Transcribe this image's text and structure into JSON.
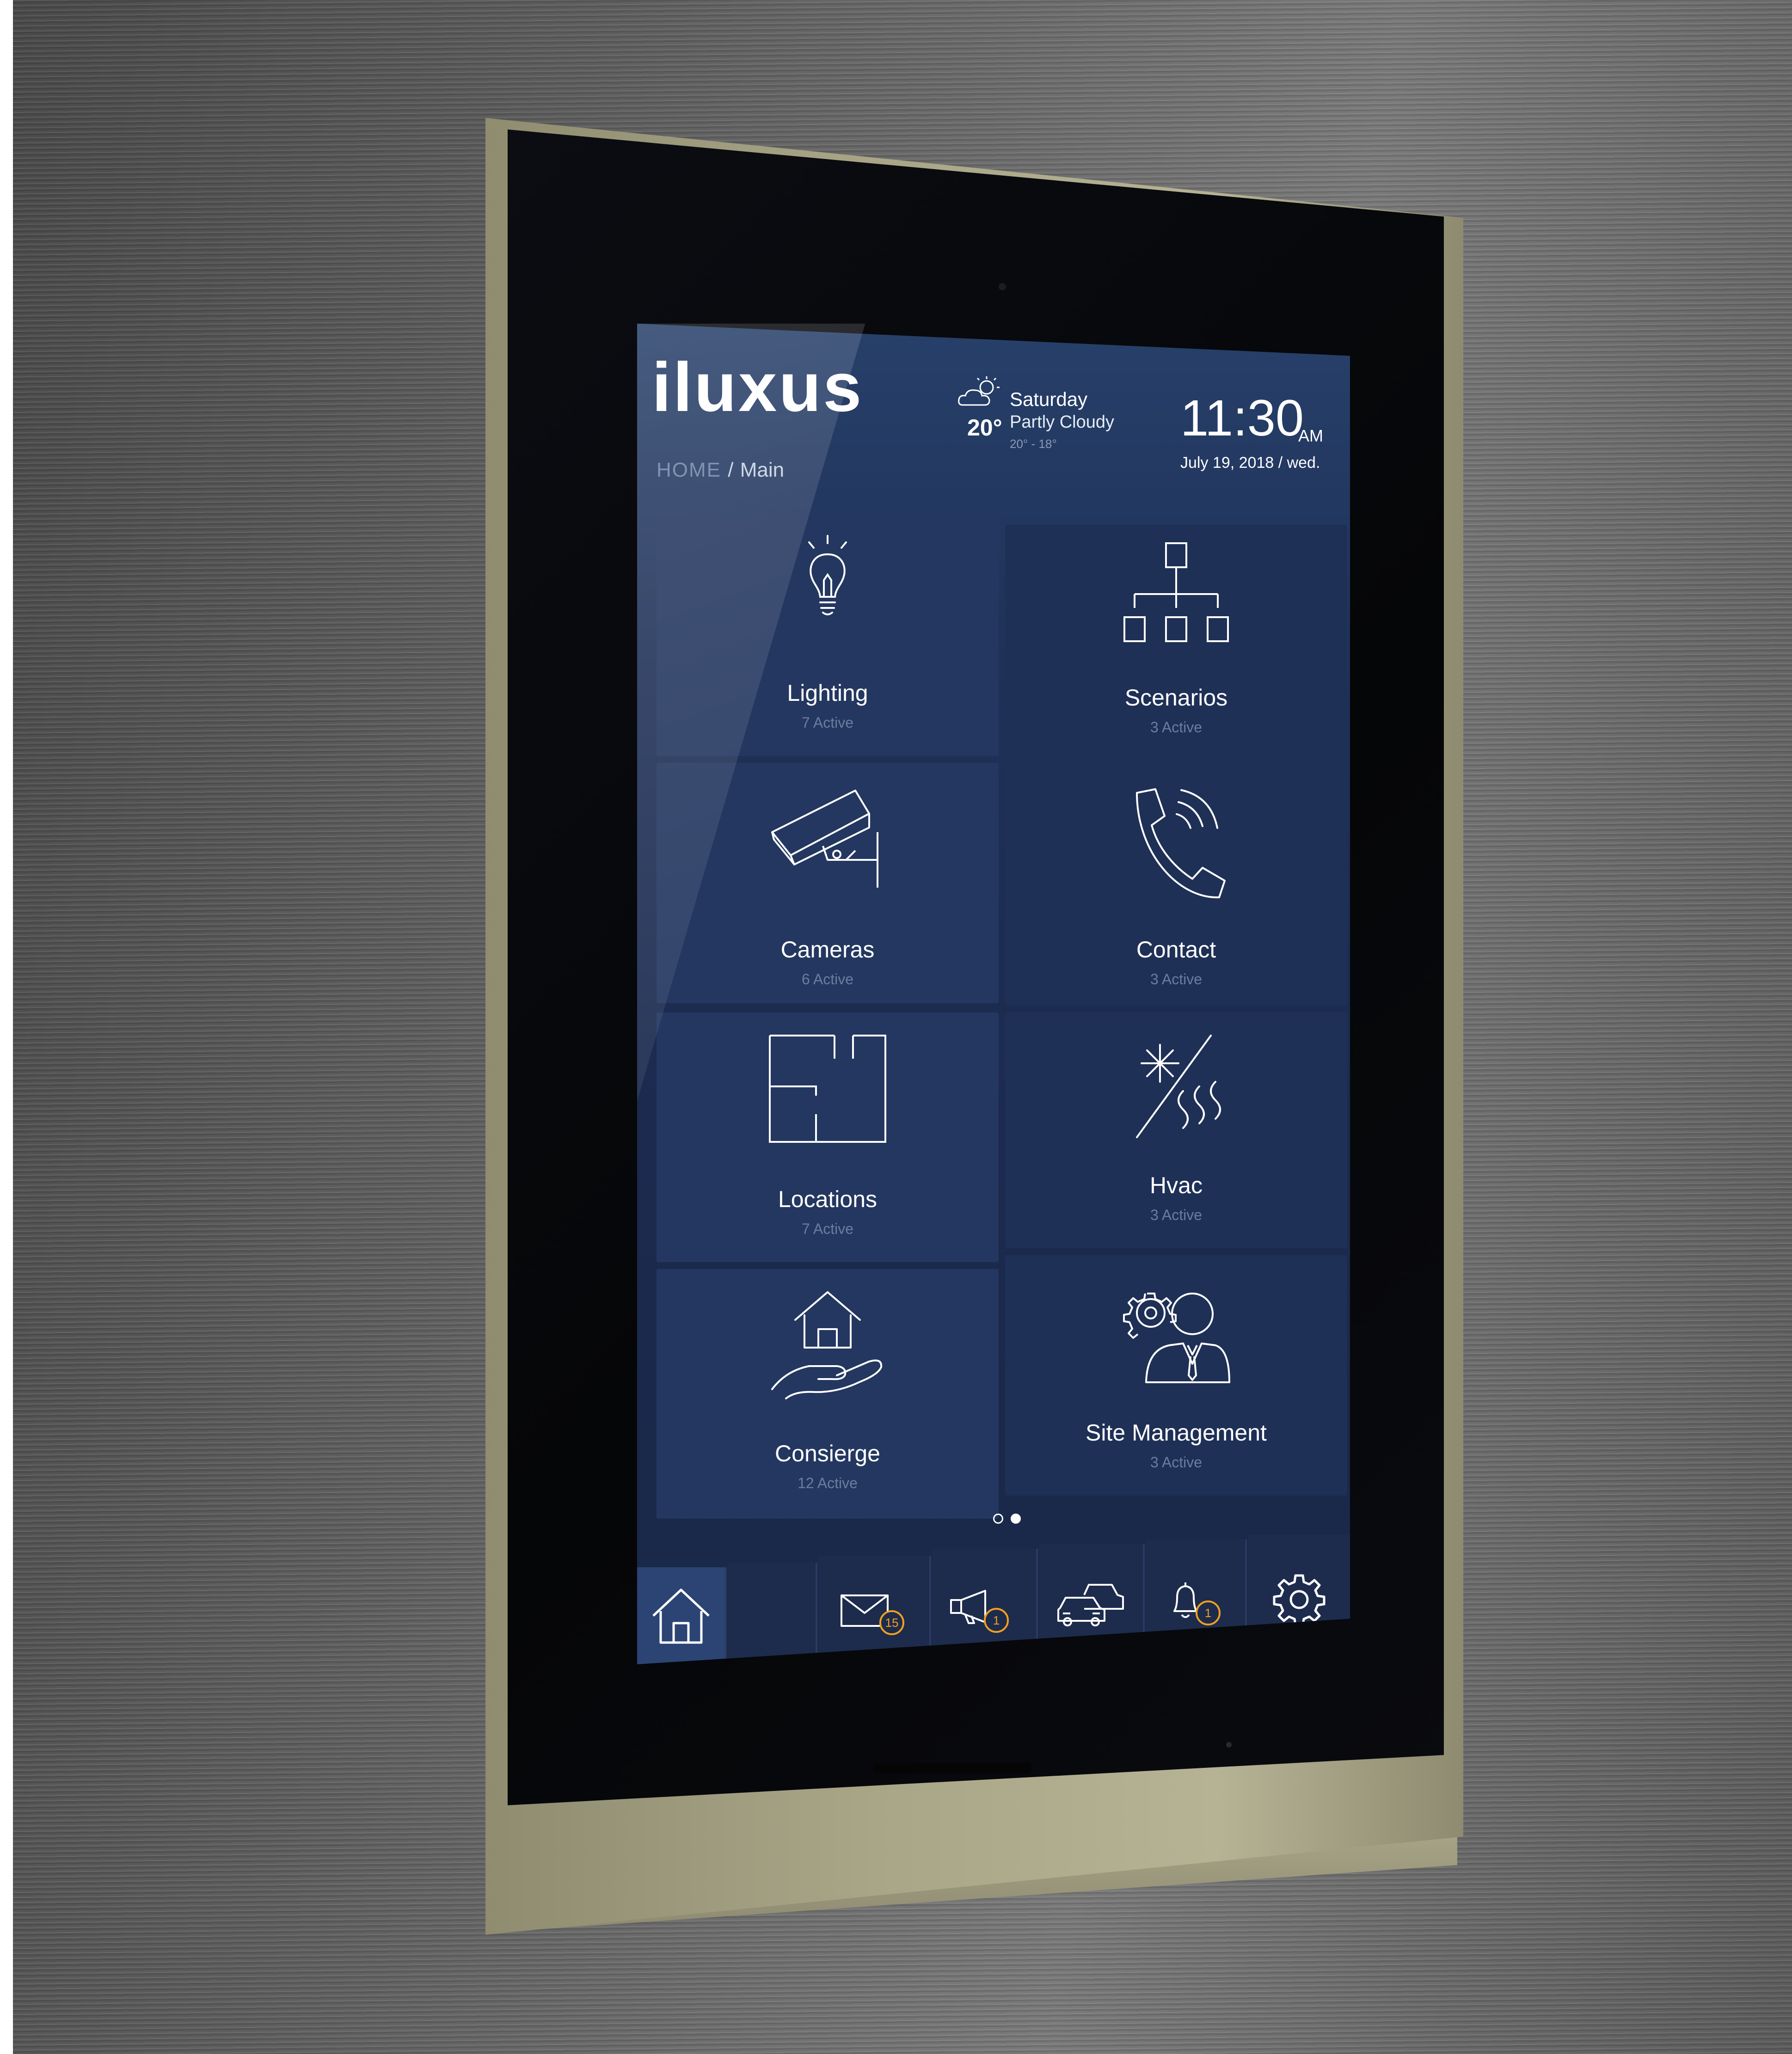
{
  "brand": {
    "logo_text": "iluxus"
  },
  "weather": {
    "icon": "partly-cloudy-icon",
    "temperature": "20°",
    "day": "Saturday",
    "condition": "Partly Cloudy",
    "range": "20° - 18°"
  },
  "clock": {
    "time": "11:30",
    "ampm": "AM",
    "date": "July 19, 2018 / wed."
  },
  "breadcrumb": {
    "root": "HOME",
    "separator": "/",
    "current": "Main"
  },
  "tiles": [
    {
      "label": "Lighting",
      "status": "7 Active",
      "icon": "lightbulb-icon"
    },
    {
      "label": "Scenarios",
      "status": "3 Active",
      "icon": "hierarchy-icon"
    },
    {
      "label": "Cameras",
      "status": "6 Active",
      "icon": "security-camera-icon"
    },
    {
      "label": "Contact",
      "status": "3 Active",
      "icon": "phone-icon"
    },
    {
      "label": "Locations",
      "status": "7 Active",
      "icon": "floorplan-icon"
    },
    {
      "label": "Hvac",
      "status": "3 Active",
      "icon": "hvac-icon"
    },
    {
      "label": "Consierge",
      "status": "12 Active",
      "icon": "hand-house-icon"
    },
    {
      "label": "Site Management",
      "status": "3 Active",
      "icon": "manager-gear-icon"
    }
  ],
  "pager": {
    "pages": 2,
    "active_page": 2
  },
  "bottom_bar": [
    {
      "icon": "home-icon",
      "badge": null
    },
    {
      "icon": "blank",
      "badge": null
    },
    {
      "icon": "mail-icon",
      "badge": "15"
    },
    {
      "icon": "megaphone-icon",
      "badge": "1"
    },
    {
      "icon": "cars-icon",
      "badge": null
    },
    {
      "icon": "bell-icon",
      "badge": "1"
    },
    {
      "icon": "gear-icon",
      "badge": null
    }
  ],
  "colors": {
    "screen_bg": "#1f3158",
    "tile_bg": "#243760",
    "badge": "#f0a01e",
    "device_frame": "#a9a688"
  }
}
